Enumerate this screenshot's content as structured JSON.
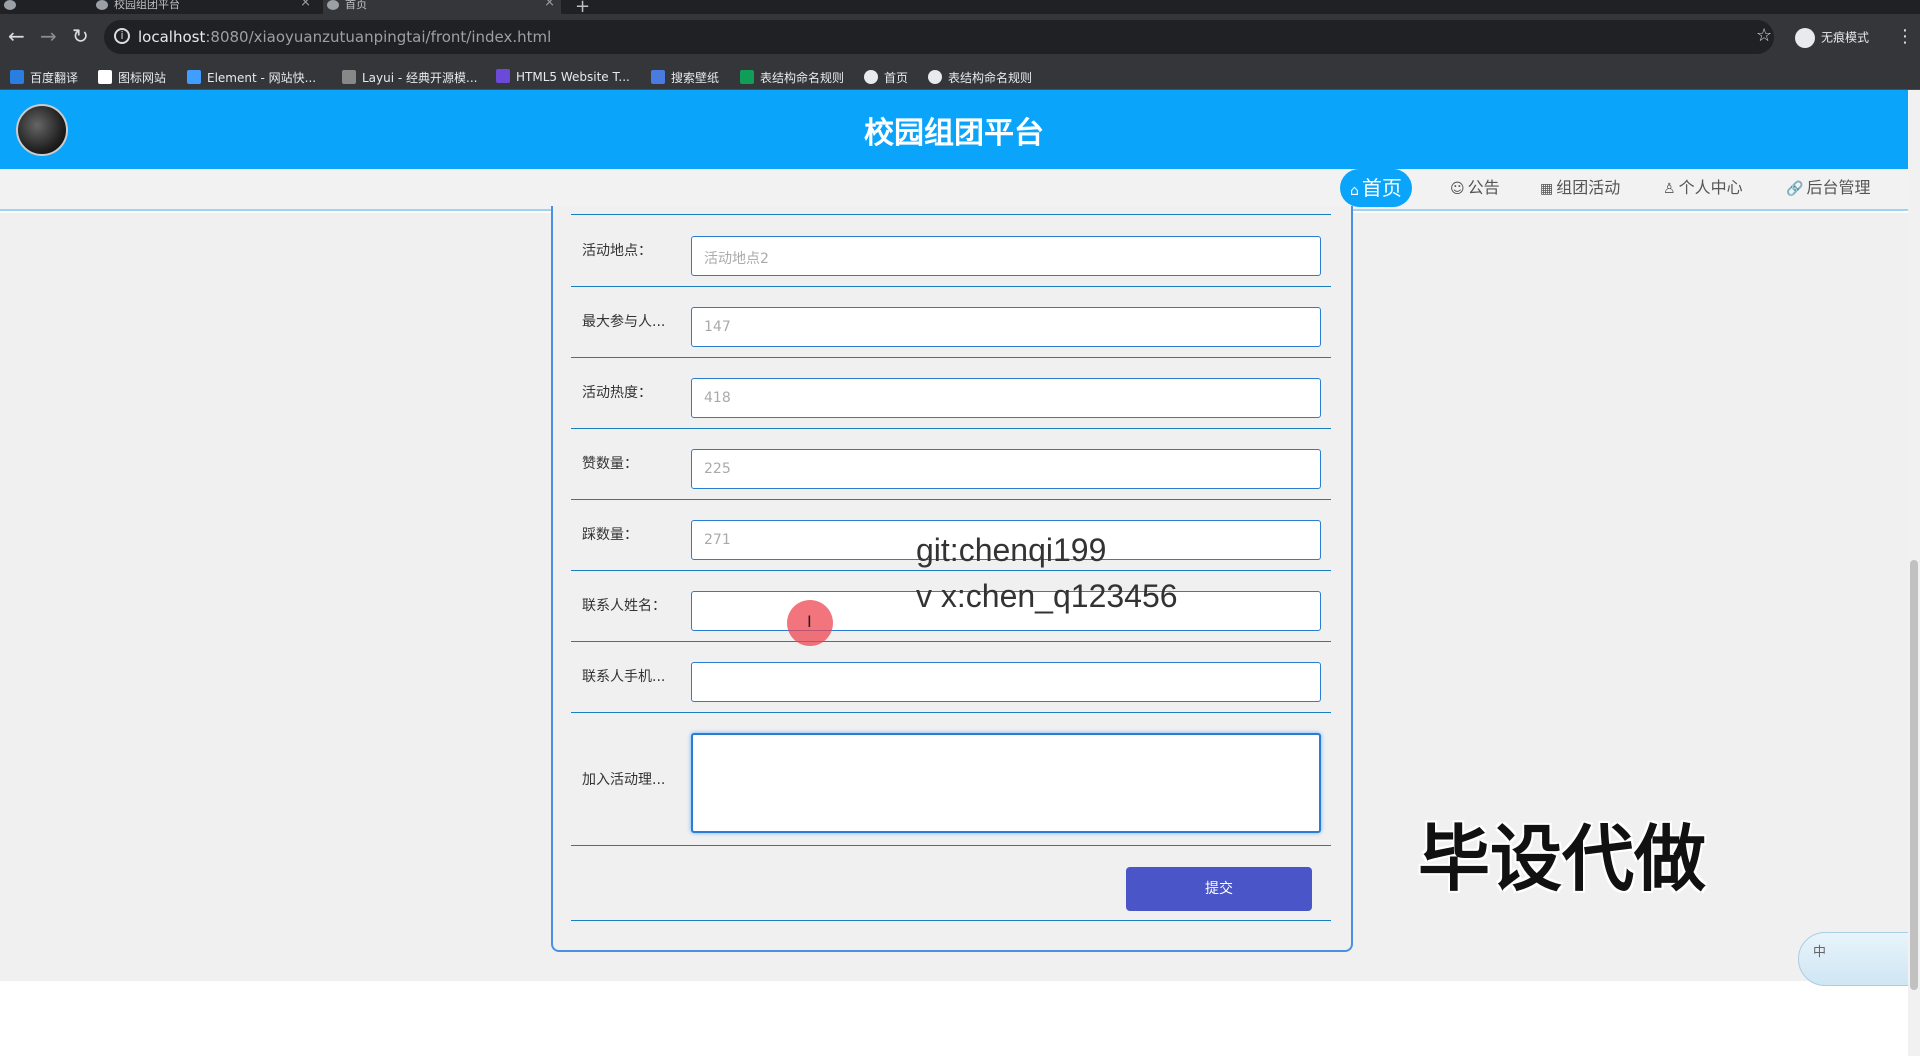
{
  "browser": {
    "tabs": [
      {
        "title": "校园组团平台",
        "active": false
      },
      {
        "title": "首页",
        "active": true
      }
    ],
    "url_host": "localhost",
    "url_rest": ":8080/xiaoyuanzutuanpingtai/front/index.html",
    "profile_label": "无痕模式",
    "bookmarks": [
      {
        "label": "百度翻译",
        "color": "#2a7de1"
      },
      {
        "label": "图标网站",
        "color": "#ffffff"
      },
      {
        "label": "Element - 网站快...",
        "color": "#409eff"
      },
      {
        "label": "Layui - 经典开源模...",
        "color": "#e8eaed"
      },
      {
        "label": "HTML5 Website T...",
        "color": "#6c4ad9"
      },
      {
        "label": "搜索壁纸",
        "color": "#4a7be0"
      },
      {
        "label": "表结构命名规则",
        "color": "#0f9d58"
      },
      {
        "label": "首页",
        "color": "#e8eaed"
      },
      {
        "label": "表结构命名规则",
        "color": "#e8eaed"
      }
    ]
  },
  "site": {
    "title": "校园组团平台",
    "brand_color": "#0aa5fb",
    "nav": [
      {
        "icon": "⌂",
        "label": "首页",
        "active": true
      },
      {
        "icon": "☺",
        "label": "公告",
        "active": false
      },
      {
        "icon": "▦",
        "label": "组团活动",
        "active": false
      },
      {
        "icon": "♙",
        "label": "个人中心",
        "active": false
      },
      {
        "icon": "🔗",
        "label": "后台管理",
        "active": false
      }
    ]
  },
  "form": {
    "fields": [
      {
        "label": "活动地点：",
        "value": "活动地点2"
      },
      {
        "label": "最大参与人...",
        "value": "147"
      },
      {
        "label": "活动热度：",
        "value": "418"
      },
      {
        "label": "赞数量：",
        "value": "225"
      },
      {
        "label": "踩数量：",
        "value": "271"
      },
      {
        "label": "联系人姓名：",
        "value": ""
      },
      {
        "label": "联系人手机...",
        "value": ""
      }
    ],
    "reason_label": "加入活动理...",
    "submit_label": "提交"
  },
  "watermark": {
    "git": "git:chenqi199",
    "vx": "v x:chen_q123456",
    "big": "毕设代做"
  },
  "ime": {
    "label": "中"
  }
}
